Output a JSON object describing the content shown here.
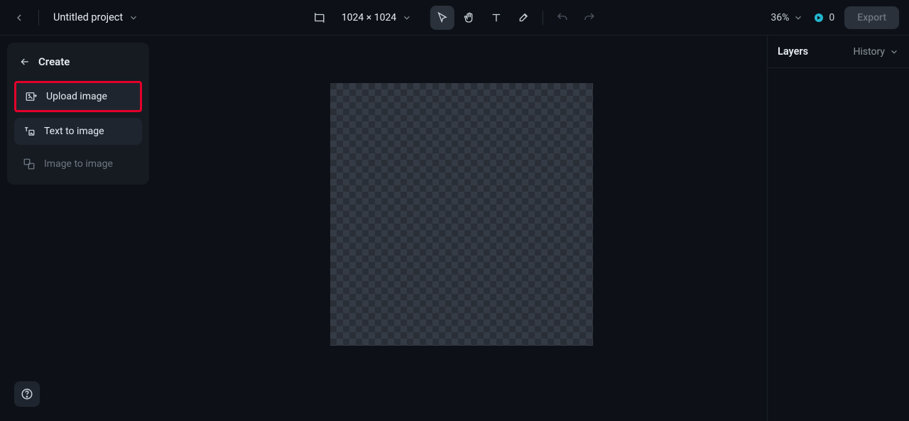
{
  "topbar": {
    "project_name": "Untitled project",
    "dimensions": "1024 × 1024",
    "zoom": "36%",
    "credits": "0",
    "export_label": "Export"
  },
  "left_panel": {
    "title": "Create",
    "items": {
      "upload": "Upload image",
      "text_to_image": "Text to image",
      "image_to_image": "Image to image"
    }
  },
  "right_panel": {
    "title": "Layers",
    "history": "History"
  }
}
